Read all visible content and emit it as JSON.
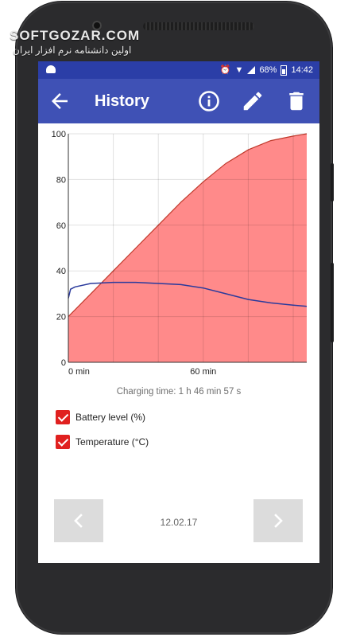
{
  "watermark": {
    "main": "SOFTGOZAR.COM",
    "sub": "اولین دانشنامه نرم افزار ایران"
  },
  "status_bar": {
    "battery_percent": "68%",
    "time": "14:42",
    "icons": [
      "android-icon",
      "alarm-icon",
      "wifi-icon",
      "signal-icon",
      "battery-charging-icon"
    ]
  },
  "app_bar": {
    "title": "History",
    "background_color": "#3f51b5",
    "status_color": "#2b3ea7",
    "icons": [
      "back-arrow-icon",
      "info-icon",
      "edit-pencil-icon",
      "delete-trash-icon"
    ]
  },
  "chart_data": {
    "type": "area",
    "x_unit": "min",
    "x_tick_labels": [
      "0 min",
      "60 min"
    ],
    "y_ticks": [
      0,
      20,
      40,
      60,
      80,
      100
    ],
    "ylim": [
      0,
      100
    ],
    "xlim": [
      0,
      106
    ],
    "grid": true,
    "series": [
      {
        "name": "Battery level (%)",
        "style": "area",
        "fill_color": "#ff8a8a",
        "line_color": "#c0392b",
        "x": [
          0,
          10,
          20,
          30,
          40,
          50,
          60,
          70,
          80,
          90,
          100,
          106
        ],
        "y": [
          20,
          30,
          40,
          50,
          60,
          70,
          79,
          87,
          93,
          97,
          99,
          100
        ]
      },
      {
        "name": "Temperature (°C)",
        "style": "line",
        "line_color": "#2a3a9c",
        "x": [
          0,
          1,
          3,
          10,
          20,
          30,
          40,
          50,
          60,
          70,
          80,
          90,
          100,
          106
        ],
        "y": [
          28,
          32,
          33,
          34.5,
          35,
          35,
          34.5,
          34,
          32.5,
          30,
          27.5,
          26,
          25,
          24.5
        ]
      }
    ]
  },
  "charging_time": "Charging time: 1 h 46 min 57 s",
  "legend": [
    {
      "label": "Battery level (%)",
      "checked": true
    },
    {
      "label": "Temperature (°C)",
      "checked": true
    }
  ],
  "checkbox_color": "#e0201f",
  "navigation": {
    "date": "12.02.17",
    "prev_icon": "chevron-left-icon",
    "next_icon": "chevron-right-icon"
  }
}
